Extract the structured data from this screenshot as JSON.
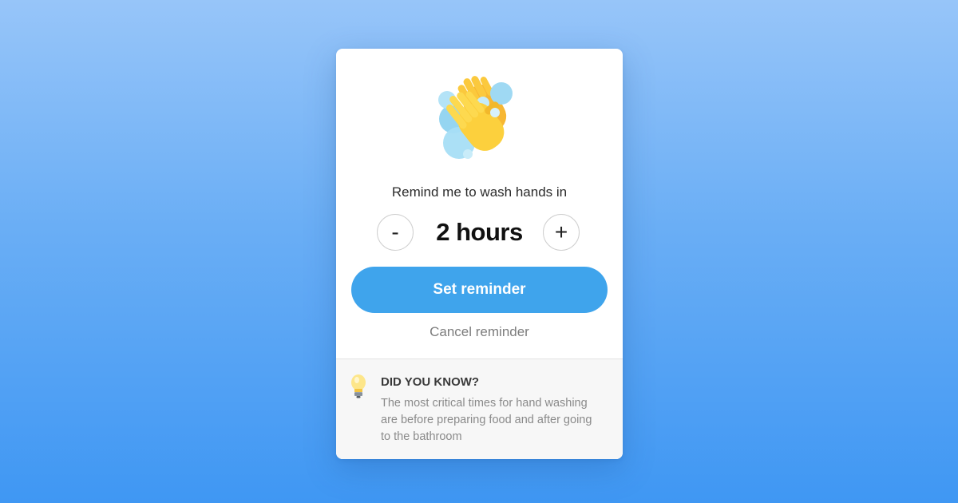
{
  "reminder": {
    "icon": "washing-hands-emoji",
    "prompt": "Remind me to wash hands in",
    "decrement_label": "-",
    "increment_label": "+",
    "duration": "2 hours",
    "set_label": "Set reminder",
    "cancel_label": "Cancel reminder"
  },
  "tip": {
    "icon": "lightbulb-icon",
    "title": "DID YOU KNOW?",
    "body": "The most critical times for hand washing are before preparing food and after going to the bathroom"
  },
  "colors": {
    "accent": "#3fa4ec",
    "background_top": "#97c5f9",
    "background_bottom": "#3f97f3"
  }
}
